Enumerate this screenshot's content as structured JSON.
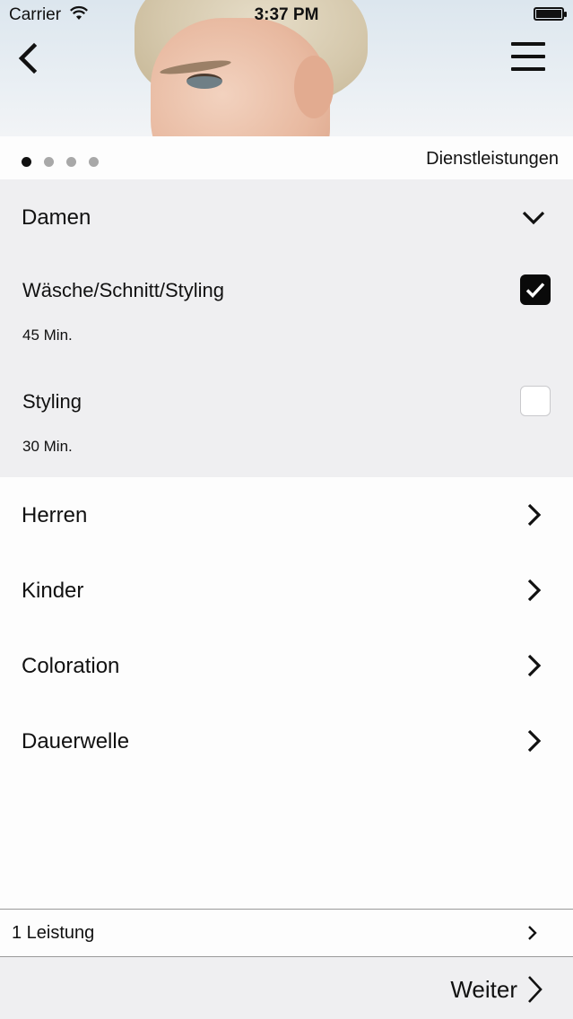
{
  "status_bar": {
    "carrier": "Carrier",
    "time": "3:37 PM"
  },
  "header": {
    "section_title": "Dienstleistungen",
    "pager": {
      "count": 4,
      "active_index": 0
    }
  },
  "expanded_category": {
    "label": "Damen",
    "services": [
      {
        "name": "Wäsche/Schnitt/Styling",
        "duration": "45 Min.",
        "selected": true
      },
      {
        "name": "Styling",
        "duration": "30 Min.",
        "selected": false
      }
    ]
  },
  "categories": [
    {
      "label": "Herren"
    },
    {
      "label": "Kinder"
    },
    {
      "label": "Coloration"
    },
    {
      "label": "Dauerwelle"
    }
  ],
  "summary": {
    "text": "1 Leistung"
  },
  "footer": {
    "next_label": "Weiter"
  },
  "icons": {
    "back": "chevron-left-icon",
    "menu": "hamburger-menu-icon",
    "expand": "chevron-down-icon",
    "navigate": "chevron-right-icon",
    "check": "checkmark-icon"
  }
}
